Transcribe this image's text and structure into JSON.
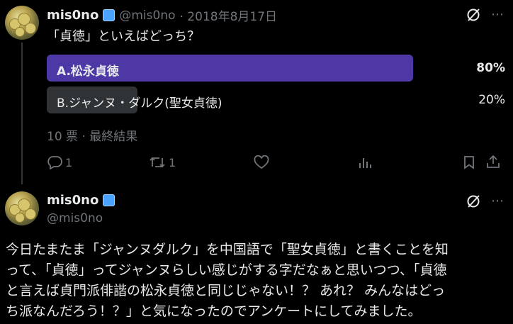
{
  "tweet1": {
    "name": "mis0no",
    "handle": "@mis0no",
    "date": "· 2018年8月17日",
    "question": "「貞徳」といえばどっち？",
    "poll": {
      "options": [
        {
          "label": "A.松永貞徳",
          "percent": "80%",
          "fraction": 0.8
        },
        {
          "label": "B.ジャンヌ・ダルク(聖女貞徳)",
          "percent": "20%",
          "fraction": 0.2
        }
      ],
      "summary": "10 票 · 最終結果"
    },
    "actions": {
      "reply_count": "1",
      "retweet_count": "1"
    }
  },
  "tweet2": {
    "name": "mis0no",
    "handle": "@mis0no",
    "text_lines": [
      "今日たまたま「ジャンヌダルク」を中国語で「聖女貞徳」と書くことを知",
      "って、「貞徳」ってジャンヌらしい感じがする字だなぁと思いつつ、「貞徳",
      "と言えば貞門派俳諧の松永貞徳と同じじゃない！？ あれ？ みんなはどっ",
      "ち派なんだろう！？」と気になったのでアンケートにしてみました。"
    ]
  },
  "icons": {
    "grok": "grok-icon",
    "reply": "reply-icon",
    "retweet": "retweet-icon",
    "like": "like-icon",
    "views": "views-icon",
    "bookmark": "bookmark-icon",
    "share": "share-icon"
  },
  "colors": {
    "background": "#000000",
    "winner_bar": "#4e38a6",
    "loser_bar": "#2f3336",
    "muted_text": "#71767b"
  }
}
